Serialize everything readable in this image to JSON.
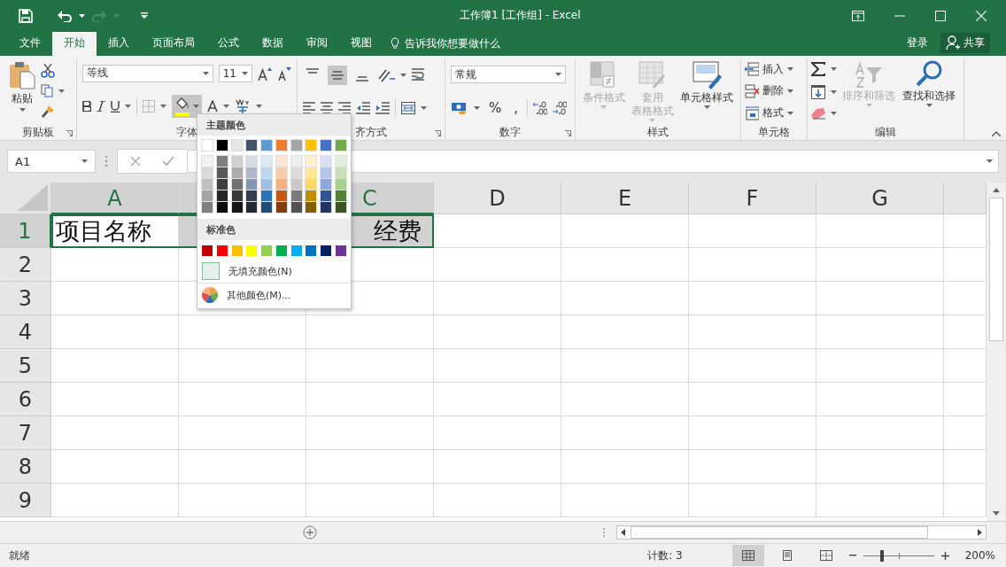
{
  "title_bar": {
    "title": "工作簿1  [工作组] - Excel"
  },
  "menu_tabs": [
    {
      "label": "文件",
      "selected": false
    },
    {
      "label": "开始",
      "selected": true
    },
    {
      "label": "插入",
      "selected": false
    },
    {
      "label": "页面布局",
      "selected": false
    },
    {
      "label": "公式",
      "selected": false
    },
    {
      "label": "数据",
      "selected": false
    },
    {
      "label": "审阅",
      "selected": false
    },
    {
      "label": "视图",
      "selected": false
    }
  ],
  "tell_me": "告诉我你想要做什么",
  "sign_in": "登录",
  "share": "共享",
  "ribbon": {
    "clipboard": {
      "paste": "粘贴",
      "label": "剪贴板"
    },
    "font": {
      "font_name": "等线",
      "font_size": "11",
      "fill_swatch": {
        "color": "#ffff00"
      },
      "label": "字体"
    },
    "alignment": {
      "vertical_align": [
        {
          "selected": false
        },
        {
          "selected": true
        },
        {
          "selected": false
        }
      ],
      "label": "齐方式"
    },
    "number": {
      "format": "常规",
      "percent": "%",
      "comma": ",",
      "label": "数字"
    },
    "styles": {
      "buttons": [
        {
          "lines": [
            "条件格式"
          ],
          "kind": "conditional",
          "disabled": true
        },
        {
          "lines": [
            "套用",
            "表格格式"
          ],
          "kind": "table",
          "disabled": true
        },
        {
          "lines": [
            "单元格样式"
          ],
          "kind": "cellstyle",
          "disabled": false
        }
      ],
      "label": "样式"
    },
    "cells": {
      "buttons": [
        {
          "label": "插入",
          "kind": "insert"
        },
        {
          "label": "删除",
          "kind": "delete"
        },
        {
          "label": "格式",
          "kind": "format"
        }
      ],
      "label": "单元格"
    },
    "editing": {
      "buttons": [
        {
          "label": "排序和筛选",
          "kind": "sort",
          "disabled": true
        },
        {
          "label": "查找和选择",
          "kind": "find",
          "disabled": false
        }
      ],
      "label": "编辑"
    }
  },
  "name_box": "A1",
  "fill_menu": {
    "theme_title": "主题颜色",
    "theme_colors": [
      {
        "color": "#ffffff",
        "shades": [
          {
            "color": "#f2f2f2"
          },
          {
            "color": "#d9d9d9"
          },
          {
            "color": "#bfbfbf"
          },
          {
            "color": "#a6a6a6"
          },
          {
            "color": "#808080"
          }
        ]
      },
      {
        "color": "#000000",
        "shades": [
          {
            "color": "#7f7f7f"
          },
          {
            "color": "#595959"
          },
          {
            "color": "#404040"
          },
          {
            "color": "#262626"
          },
          {
            "color": "#0d0d0d"
          }
        ]
      },
      {
        "color": "#e7e6e6",
        "shades": [
          {
            "color": "#d0cece"
          },
          {
            "color": "#aeaaaa"
          },
          {
            "color": "#757171"
          },
          {
            "color": "#3a3838"
          },
          {
            "color": "#171616"
          }
        ]
      },
      {
        "color": "#44546a",
        "shades": [
          {
            "color": "#d6dce4"
          },
          {
            "color": "#acb9ca"
          },
          {
            "color": "#8497b0"
          },
          {
            "color": "#333f4f"
          },
          {
            "color": "#222b35"
          }
        ]
      },
      {
        "color": "#5b9bd5",
        "shades": [
          {
            "color": "#ddebf7"
          },
          {
            "color": "#bdd7ee"
          },
          {
            "color": "#9bc2e6"
          },
          {
            "color": "#2f75b5"
          },
          {
            "color": "#1f4e78"
          }
        ]
      },
      {
        "color": "#ed7d31",
        "shades": [
          {
            "color": "#fce4d6"
          },
          {
            "color": "#f8cbad"
          },
          {
            "color": "#f4b084"
          },
          {
            "color": "#c65911"
          },
          {
            "color": "#833c0c"
          }
        ]
      },
      {
        "color": "#a5a5a5",
        "shades": [
          {
            "color": "#ededed"
          },
          {
            "color": "#dbdbdb"
          },
          {
            "color": "#c9c9c9"
          },
          {
            "color": "#7b7b7b"
          },
          {
            "color": "#525252"
          }
        ]
      },
      {
        "color": "#ffc000",
        "shades": [
          {
            "color": "#fff2cc"
          },
          {
            "color": "#ffe699"
          },
          {
            "color": "#ffd966"
          },
          {
            "color": "#bf8f00"
          },
          {
            "color": "#806000"
          }
        ]
      },
      {
        "color": "#4472c4",
        "shades": [
          {
            "color": "#d9e1f2"
          },
          {
            "color": "#b4c6e7"
          },
          {
            "color": "#8ea9db"
          },
          {
            "color": "#305496"
          },
          {
            "color": "#203764"
          }
        ]
      },
      {
        "color": "#70ad47",
        "shades": [
          {
            "color": "#e2efda"
          },
          {
            "color": "#c6e0b4"
          },
          {
            "color": "#a9d08e"
          },
          {
            "color": "#548235"
          },
          {
            "color": "#375623"
          }
        ]
      }
    ],
    "standard_title": "标准色",
    "standard_colors": [
      {
        "color": "#c00000"
      },
      {
        "color": "#ff0000"
      },
      {
        "color": "#ffc000"
      },
      {
        "color": "#ffff00"
      },
      {
        "color": "#92d050"
      },
      {
        "color": "#00b050"
      },
      {
        "color": "#00b0f0"
      },
      {
        "color": "#0070c0"
      },
      {
        "color": "#002060"
      },
      {
        "color": "#7030a0"
      }
    ],
    "no_fill": "无填充颜色(N)",
    "more_colors": "其他颜色(M)..."
  },
  "sheet": {
    "columns": [
      {
        "label": "A",
        "selected": true
      },
      {
        "selected": true
      },
      {
        "label": "C",
        "selected": true
      },
      {
        "label": "D",
        "selected": false
      },
      {
        "label": "E",
        "selected": false
      },
      {
        "label": "F",
        "selected": false
      },
      {
        "label": "G",
        "selected": false
      }
    ],
    "rows": [
      {
        "label": "1",
        "selected": true,
        "cells": [
          {
            "text": "项目名称",
            "selected": true,
            "active": true
          },
          {
            "selected": true,
            "active": false
          },
          {
            "text": "经费",
            "selected": true,
            "active": false
          }
        ]
      },
      {
        "label": "2",
        "selected": false,
        "cells": []
      },
      {
        "label": "3",
        "selected": false,
        "cells": []
      },
      {
        "label": "4",
        "selected": false,
        "cells": []
      },
      {
        "label": "5",
        "selected": false,
        "cells": []
      },
      {
        "label": "6",
        "selected": false,
        "cells": []
      },
      {
        "label": "7",
        "selected": false,
        "cells": []
      },
      {
        "label": "8",
        "selected": false,
        "cells": []
      },
      {
        "label": "9",
        "selected": false,
        "cells": []
      }
    ]
  },
  "status_bar": {
    "status": "就绪",
    "count": "计数: 3",
    "views": [
      {
        "selected": true
      },
      {
        "selected": false
      },
      {
        "selected": false
      }
    ],
    "zoom": {
      "level": 0.27,
      "label": "200%"
    }
  }
}
